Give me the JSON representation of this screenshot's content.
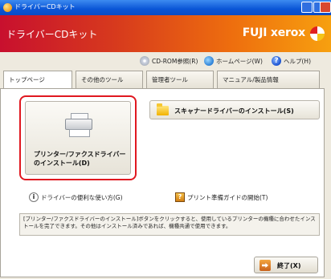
{
  "window": {
    "title": "ドライバーCDキット",
    "icon": "cd-kit-icon"
  },
  "banner": {
    "app_name": "ドライバーCDキット",
    "brand": "FUJI xerox"
  },
  "toplinks": [
    {
      "label": "CD-ROM参照(R)",
      "icon": "cd-icon"
    },
    {
      "label": "ホームページ(W)",
      "icon": "globe-icon"
    },
    {
      "label": "ヘルプ(H)",
      "icon": "help-icon"
    }
  ],
  "tabs": [
    {
      "label": "トップページ",
      "active": true
    },
    {
      "label": "その他のツール",
      "active": false
    },
    {
      "label": "管理者ツール",
      "active": false
    },
    {
      "label": "マニュアル/製品情報",
      "active": false
    }
  ],
  "main": {
    "printer_install_label": "プリンター/ファクスドライバーのインストール(D)",
    "scanner_install_label": "スキャナードライバーのインストール(S)",
    "usage_link": "ドライバーの便利な使い方(G)",
    "guide_link": "プリント準備ガイドの開始(T)",
    "description": "[プリンター/ファクスドライバーのインストール]ボタンをクリックすると、使用しているプリンターの機種に合わせたインストールを完了できます。その他はインストール済みであれば、機種共通で使用できます。",
    "exit_label": "終了(X)"
  },
  "colors": {
    "highlight": "#e01820",
    "banner_start": "#c8102e",
    "banner_end": "#f7a00f"
  }
}
